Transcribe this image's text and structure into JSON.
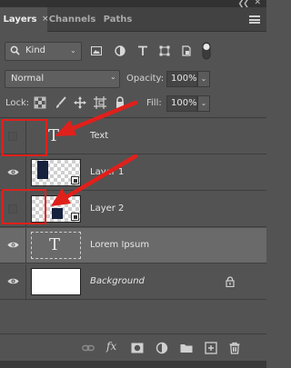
{
  "tabs": {
    "layers": "Layers",
    "channels": "Channels",
    "paths": "Paths"
  },
  "filter": {
    "kind": "Kind"
  },
  "blend": {
    "mode": "Normal",
    "opacity_label": "Opacity:",
    "opacity_value": "100%"
  },
  "lock": {
    "label": "Lock:",
    "fill_label": "Fill:",
    "fill_value": "100%"
  },
  "layers": [
    {
      "name": "Text",
      "visible": false,
      "type": "text"
    },
    {
      "name": "Layer 1",
      "visible": true,
      "type": "smart-object"
    },
    {
      "name": "Layer 2",
      "visible": false,
      "type": "smart-object"
    },
    {
      "name": "Lorem Ipsum",
      "visible": true,
      "type": "text",
      "selected": true
    },
    {
      "name": "Background",
      "visible": true,
      "type": "background",
      "locked": true
    }
  ],
  "colors": {
    "panel_bg": "#535353",
    "selected_row": "#6a6a6a",
    "annotation_red": "#e0201b",
    "thumb_navy": "#16213d"
  }
}
